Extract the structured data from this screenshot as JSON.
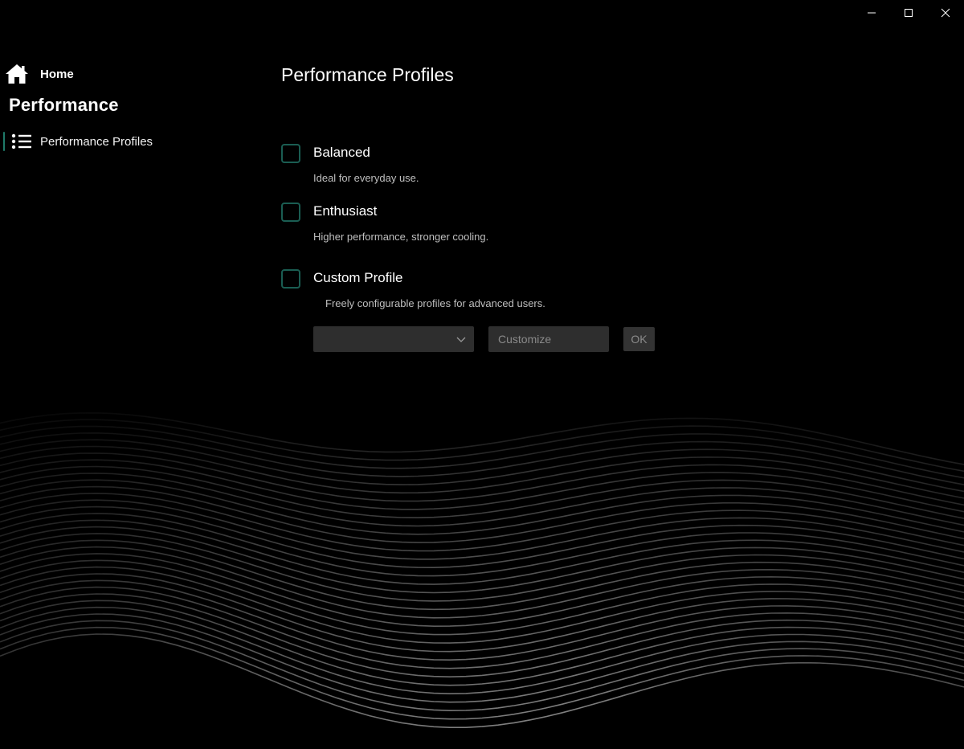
{
  "window": {
    "minimize_icon": "minimize-icon",
    "maximize_icon": "maximize-icon",
    "close_icon": "close-icon"
  },
  "sidebar": {
    "home_label": "Home",
    "home_icon": "home-icon",
    "section_title": "Performance",
    "items": [
      {
        "label": "Performance Profiles",
        "icon": "list-icon",
        "selected": true
      }
    ]
  },
  "main": {
    "title": "Performance Profiles",
    "options": [
      {
        "label": "Balanced",
        "description": "Ideal for everyday use.",
        "checked": false
      },
      {
        "label": "Enthusiast",
        "description": "Higher performance, stronger cooling.",
        "checked": false
      },
      {
        "label": "Custom Profile",
        "description": "Freely configurable profiles for advanced users.",
        "checked": false
      }
    ],
    "custom": {
      "profile_select_value": "",
      "customize_placeholder": "Customize",
      "ok_label": "OK"
    }
  },
  "colors": {
    "background": "#000000",
    "accent": "#1a5d52",
    "control_bg": "#2e2e2e",
    "muted_text": "#8a8a8a",
    "description_text": "#bfbfbf"
  }
}
